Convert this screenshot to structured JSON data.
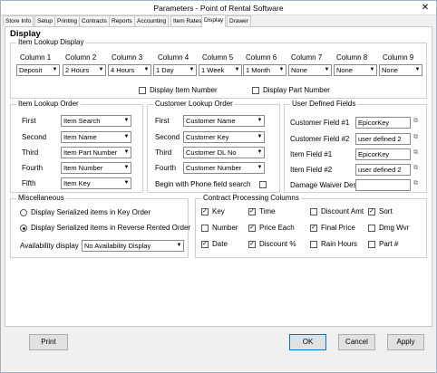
{
  "window": {
    "title": "Parameters - Point of Rental Software",
    "close": "✕"
  },
  "tabs": [
    "Store Info",
    "Setup",
    "Printing",
    "Contracts",
    "Reports",
    "Accounting",
    "Item Rates",
    "Display",
    "Drawer"
  ],
  "heading": "Display",
  "item_lookup_display": {
    "legend": "Item Lookup Display",
    "columns": [
      {
        "label": "Column 1",
        "value": "Deposit"
      },
      {
        "label": "Column 2",
        "value": "2 Hours"
      },
      {
        "label": "Column 3",
        "value": "4 Hours"
      },
      {
        "label": "Column 4",
        "value": "1 Day"
      },
      {
        "label": "Column 5",
        "value": "1 Week"
      },
      {
        "label": "Column 6",
        "value": "1 Month"
      },
      {
        "label": "Column 7",
        "value": "None"
      },
      {
        "label": "Column 8",
        "value": "None"
      },
      {
        "label": "Column 9",
        "value": "None"
      }
    ],
    "display_item_number": "Display Item Number",
    "display_part_number": "Display Part Number"
  },
  "item_lookup_order": {
    "legend": "Item Lookup Order",
    "rows": [
      {
        "label": "First",
        "value": "Item Search"
      },
      {
        "label": "Second",
        "value": "Item Name"
      },
      {
        "label": "Third",
        "value": "Item Part Number"
      },
      {
        "label": "Fourth",
        "value": "Item Number"
      },
      {
        "label": "Fifth",
        "value": "Item Key"
      }
    ]
  },
  "customer_lookup_order": {
    "legend": "Customer Lookup Order",
    "rows": [
      {
        "label": "First",
        "value": "Customer Name"
      },
      {
        "label": "Second",
        "value": "Customer Key"
      },
      {
        "label": "Third",
        "value": "Customer DL No"
      },
      {
        "label": "Fourth",
        "value": "Customer Number"
      }
    ],
    "begin_phone": "Begin with Phone field search"
  },
  "user_defined": {
    "legend": "User Defined Fields",
    "rows": [
      {
        "label": "Customer Field #1",
        "value": "EpicorKey"
      },
      {
        "label": "Customer Field #2",
        "value": "user defined 2"
      },
      {
        "label": "Item Field #1",
        "value": "EpicorKey"
      },
      {
        "label": "Item Field #2",
        "value": "user defined 2"
      },
      {
        "label": "Damage Waiver Descrip",
        "value": ""
      }
    ]
  },
  "misc": {
    "legend": "Miscellaneous",
    "radio1": "Display Serialized items in Key Order",
    "radio2": "Display Serialized items in Reverse Rented Order",
    "availability_label": "Availability display",
    "availability_value": "No Availability Display"
  },
  "contract_cols": {
    "legend": "Contract Processing Columns",
    "items": [
      {
        "label": "Key",
        "checked": true
      },
      {
        "label": "Time",
        "checked": true
      },
      {
        "label": "Discount Amt",
        "checked": false
      },
      {
        "label": "Sort",
        "checked": true
      },
      {
        "label": "Number",
        "checked": false
      },
      {
        "label": "Price Each",
        "checked": true
      },
      {
        "label": "Final Price",
        "checked": true
      },
      {
        "label": "Dmg Wvr",
        "checked": false
      },
      {
        "label": "Date",
        "checked": true
      },
      {
        "label": "Discount %",
        "checked": true
      },
      {
        "label": "Rain Hours",
        "checked": false
      },
      {
        "label": "Part #",
        "checked": false
      }
    ]
  },
  "buttons": {
    "print": "Print",
    "ok": "OK",
    "cancel": "Cancel",
    "apply": "Apply"
  },
  "glyphs": {
    "arrow": "▼",
    "check": "✓",
    "lookup": "⧉"
  }
}
